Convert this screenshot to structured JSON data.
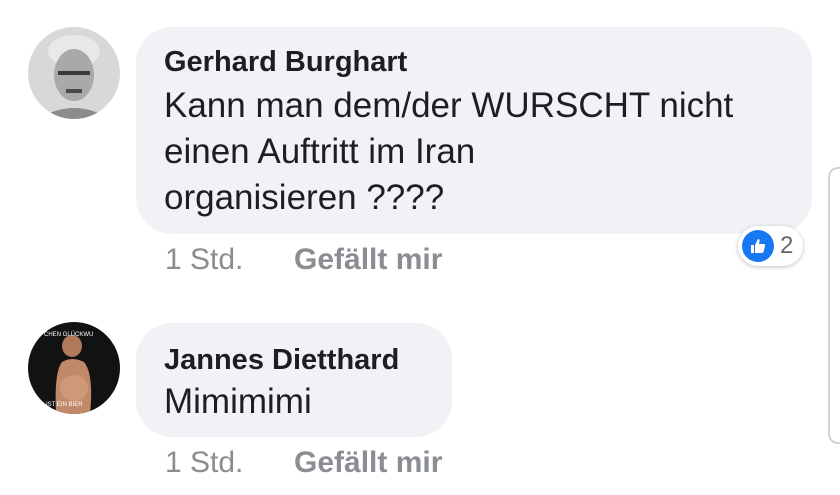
{
  "comments": [
    {
      "author": "Gerhard Burghart",
      "text": "Kann man dem/der WURSCHT nicht einen Auftritt im Iran organisieren ????",
      "lines": [
        "Kann man dem/der WURSCHT nicht",
        "einen Auftritt im Iran",
        "organisieren ????"
      ],
      "time": "1 Std.",
      "like_label": "Gefällt mir",
      "reactions": {
        "icon": "like-icon",
        "count": "2"
      }
    },
    {
      "author": "Jannes Dietthard",
      "text": "Mimimimi",
      "lines": [
        "Mimimimi"
      ],
      "time": "1 Std.",
      "like_label": "Gefällt mir",
      "avatar_overlay": {
        "top": "CHEN GLÜCKWU",
        "bottom": "IST EIN BIER"
      }
    }
  ],
  "colors": {
    "bubble": "#f0f2f5",
    "like_blue": "#1877f2",
    "meta_gray": "#8a8d91"
  }
}
